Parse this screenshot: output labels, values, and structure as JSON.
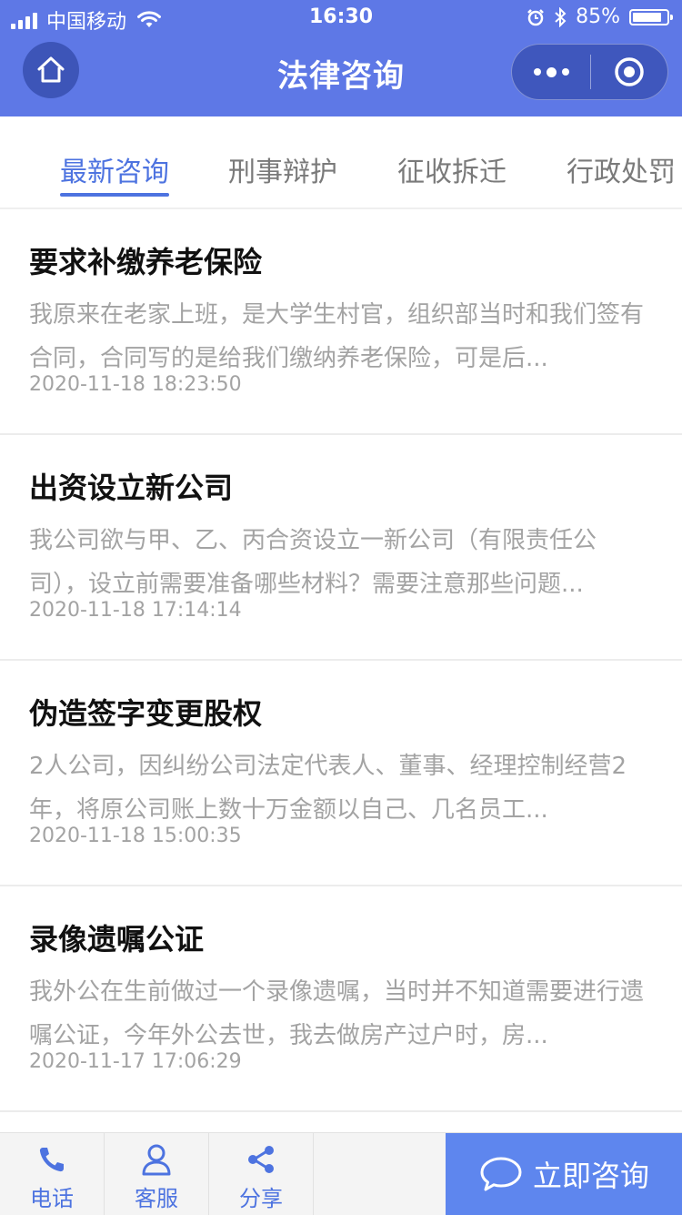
{
  "status_bar": {
    "carrier": "中国移动",
    "time": "16:30",
    "battery": "85%",
    "battery_level": 0.85
  },
  "nav": {
    "title": "法律咨询"
  },
  "tabs": [
    {
      "label": "最新咨询",
      "active": true
    },
    {
      "label": "刑事辩护",
      "active": false
    },
    {
      "label": "征收拆迁",
      "active": false
    },
    {
      "label": "行政处罚",
      "active": false
    }
  ],
  "items": [
    {
      "title": "要求补缴养老保险",
      "desc": "我原来在老家上班，是大学生村官，组织部当时和我们签有合同，合同写的是给我们缴纳养老保险，可是后...",
      "date": "2020-11-18 18:23:50"
    },
    {
      "title": "出资设立新公司",
      "desc": "我公司欲与甲、乙、丙合资设立一新公司（有限责任公司），设立前需要准备哪些材料？需要注意那些问题...",
      "date": "2020-11-18 17:14:14"
    },
    {
      "title": "伪造签字变更股权",
      "desc": "2人公司，因纠纷公司法定代表人、董事、经理控制经营2年，将原公司账上数十万金额以自己、几名员工...",
      "date": "2020-11-18 15:00:35"
    },
    {
      "title": "录像遗嘱公证",
      "desc": "我外公在生前做过一个录像遗嘱，当时并不知道需要进行遗嘱公证，今年外公去世，我去做房产过户时，房...",
      "date": "2020-11-17 17:06:29"
    }
  ],
  "bottom_bar": {
    "phone": "电话",
    "service": "客服",
    "share": "分享",
    "consult": "立即咨询"
  },
  "colors": {
    "header": "#5e78e6",
    "accent": "#4d73e0",
    "consult_button": "#5e86ee"
  }
}
